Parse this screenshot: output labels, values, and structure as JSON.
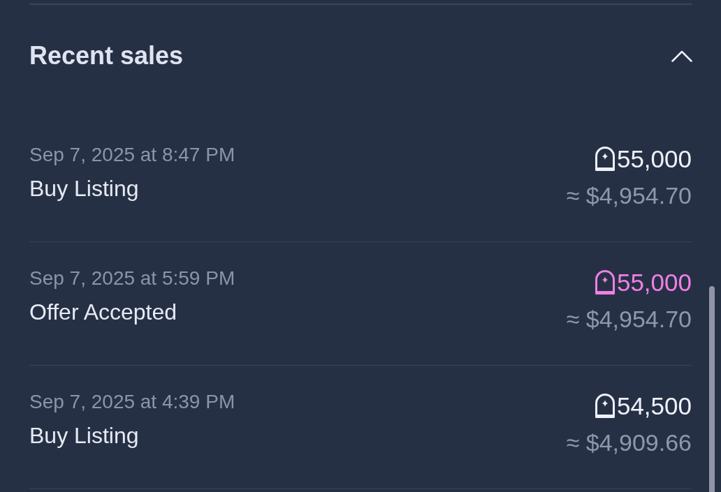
{
  "section": {
    "title": "Recent sales",
    "expanded": true
  },
  "sales": [
    {
      "date": "Sep 7, 2025 at 8:47 PM",
      "type": "Buy Listing",
      "price": "55,000",
      "usd": "≈ $4,954.70",
      "color": "#eef1f7"
    },
    {
      "date": "Sep 7, 2025 at 5:59 PM",
      "type": "Offer Accepted",
      "price": "55,000",
      "usd": "≈ $4,954.70",
      "color": "#f07fe4"
    },
    {
      "date": "Sep 7, 2025 at 4:39 PM",
      "type": "Buy Listing",
      "price": "54,500",
      "usd": "≈ $4,909.66",
      "color": "#eef1f7"
    }
  ]
}
